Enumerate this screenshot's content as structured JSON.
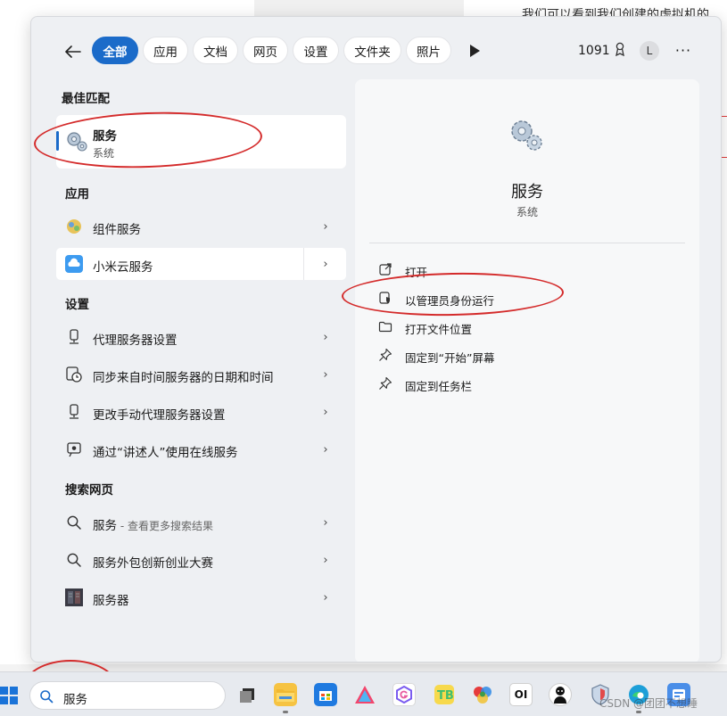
{
  "background": {
    "text": "我们可以看到我们创建的虚拟机的"
  },
  "filters": {
    "chips": [
      "全部",
      "应用",
      "文档",
      "网页",
      "设置",
      "文件夹",
      "照片"
    ],
    "active": "全部",
    "points": "1091",
    "avatar_letter": "L",
    "more": "···"
  },
  "best_match": {
    "section": "最佳匹配",
    "title": "服务",
    "subtitle": "系统",
    "icon": "services-gear-icon"
  },
  "apps": {
    "section": "应用",
    "items": [
      {
        "label": "组件服务",
        "icon": "component-services-icon"
      },
      {
        "label": "小米云服务",
        "icon": "xiaomi-cloud-icon"
      }
    ]
  },
  "settings": {
    "section": "设置",
    "items": [
      {
        "label": "代理服务器设置",
        "icon": "proxy-icon"
      },
      {
        "label": "同步来自时间服务器的日期和时间",
        "icon": "clock-icon"
      },
      {
        "label": "更改手动代理服务器设置",
        "icon": "proxy-icon"
      },
      {
        "label": "通过“讲述人”使用在线服务",
        "icon": "narrator-icon"
      }
    ]
  },
  "web": {
    "section": "搜索网页",
    "items": [
      {
        "label": "服务",
        "suffix": " - 查看更多搜索结果",
        "icon": "search-icon"
      },
      {
        "label": "服务外包创新创业大赛",
        "suffix": "",
        "icon": "search-icon"
      },
      {
        "label": "服务器",
        "suffix": "",
        "icon": "server-image-icon"
      }
    ]
  },
  "detail": {
    "title": "服务",
    "subtitle": "系统",
    "actions": [
      {
        "label": "打开",
        "icon": "open-external-icon"
      },
      {
        "label": "以管理员身份运行",
        "icon": "shield-icon"
      },
      {
        "label": "打开文件位置",
        "icon": "folder-icon"
      },
      {
        "label": "固定到“开始”屏幕",
        "icon": "pin-icon"
      },
      {
        "label": "固定到任务栏",
        "icon": "pin-icon"
      }
    ]
  },
  "taskbar": {
    "search_value": "服务",
    "apps": [
      "task-view",
      "file-explorer",
      "microsoft-store",
      "app-a",
      "app-g",
      "app-tb",
      "app-color",
      "app-oi",
      "app-avatar",
      "app-shield",
      "app-edge",
      "app-extra"
    ],
    "watermark": "CSDN @团团不想睡"
  },
  "colors": {
    "accent": "#1b6bc9",
    "annotation": "#d42b2b"
  }
}
